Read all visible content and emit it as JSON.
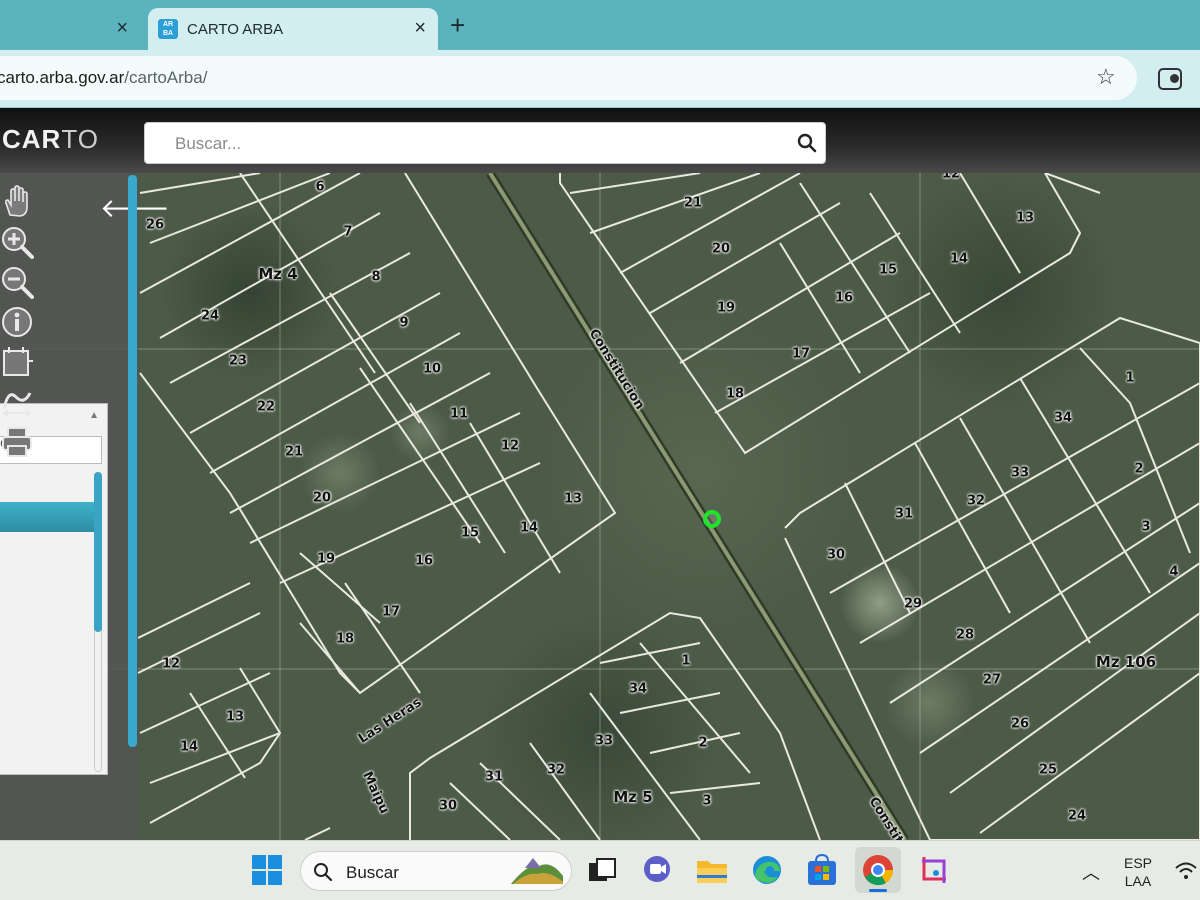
{
  "browser": {
    "tabs": [
      {
        "label": "",
        "active": false
      },
      {
        "label": "CARTO ARBA",
        "active": true,
        "favicon_text": [
          "AR",
          "BA"
        ]
      }
    ],
    "new_tab_label": "+",
    "close_glyph": "×",
    "url_domain": "carto.arba.gov.ar",
    "url_path": "/cartoArba/"
  },
  "app": {
    "logo_bold": "CAR",
    "logo_thin": "TO",
    "search_placeholder": "Buscar..."
  },
  "map": {
    "parcel_labels": [
      "6",
      "7",
      "8",
      "9",
      "10",
      "11",
      "12",
      "13",
      "14",
      "15",
      "16",
      "17",
      "18",
      "19",
      "20",
      "21",
      "22",
      "23",
      "24",
      "26",
      "12",
      "13",
      "14",
      "21",
      "20",
      "19",
      "18",
      "17",
      "16",
      "15",
      "14",
      "13",
      "12",
      "1",
      "34",
      "2",
      "33",
      "32",
      "31",
      "3",
      "4",
      "30",
      "29",
      "28",
      "27",
      "26",
      "25",
      "24",
      "1",
      "34",
      "33",
      "2",
      "32",
      "31",
      "30",
      "3"
    ],
    "block_labels": [
      "Mz 4",
      "Mz 106",
      "Mz 5"
    ],
    "streets": [
      "Constitucion",
      "Las Heras",
      "Maipu",
      "Constit"
    ],
    "marker_color": "#21e22a"
  },
  "taskbar": {
    "search_text": "Buscar",
    "language": "ESP",
    "layout": "LAA"
  }
}
